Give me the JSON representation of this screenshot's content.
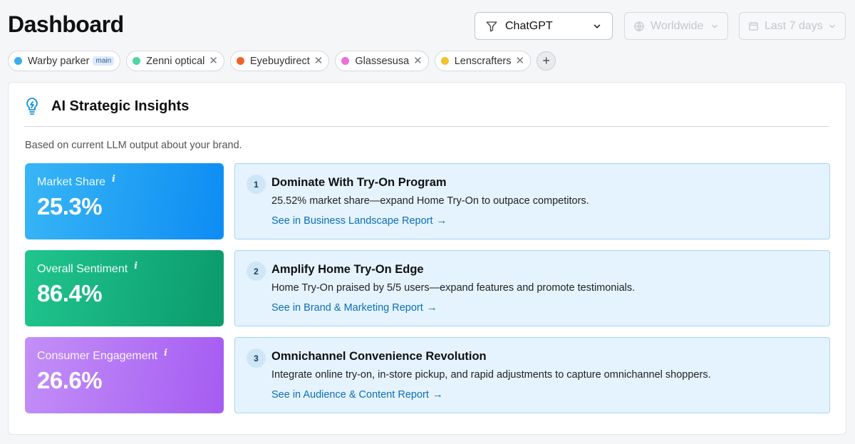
{
  "header": {
    "title": "Dashboard"
  },
  "filters": {
    "model": {
      "value": "ChatGPT",
      "icon": "filter-icon"
    },
    "region": {
      "value": "Worldwide",
      "icon": "globe-icon"
    },
    "period": {
      "value": "Last 7 days",
      "icon": "calendar-icon"
    }
  },
  "brands": [
    {
      "name": "Warby parker",
      "badge": "main",
      "color": "#3aaef0"
    },
    {
      "name": "Zenni optical",
      "color": "#4fd4a2"
    },
    {
      "name": "Eyebuydirect",
      "color": "#f0622b"
    },
    {
      "name": "Glassesusa",
      "color": "#ec6fd6"
    },
    {
      "name": "Lenscrafters",
      "color": "#f2c230"
    }
  ],
  "panel": {
    "title": "AI Strategic Insights",
    "subtitle": "Based on current LLM output about your brand."
  },
  "metrics": [
    {
      "label": "Market Share",
      "info": "i",
      "value": "25.3%"
    },
    {
      "label": "Overall Sentiment",
      "info": "i",
      "value": "86.4%"
    },
    {
      "label": "Consumer Engagement",
      "info": "i",
      "value": "26.6%"
    }
  ],
  "insights": [
    {
      "number": "1",
      "title": "Dominate With Try-On Program",
      "description": "25.52% market share—expand Home Try-On to outpace competitors.",
      "link": "See in Business Landscape Report"
    },
    {
      "number": "2",
      "title": "Amplify Home Try-On Edge",
      "description": "Home Try-On praised by 5/5 users—expand features and promote testimonials.",
      "link": "See in Brand & Marketing Report"
    },
    {
      "number": "3",
      "title": "Omnichannel Convenience Revolution",
      "description": "Integrate online try-on, in-store pickup, and rapid adjustments to capture omnichannel shoppers.",
      "link": "See in Audience & Content Report"
    }
  ]
}
